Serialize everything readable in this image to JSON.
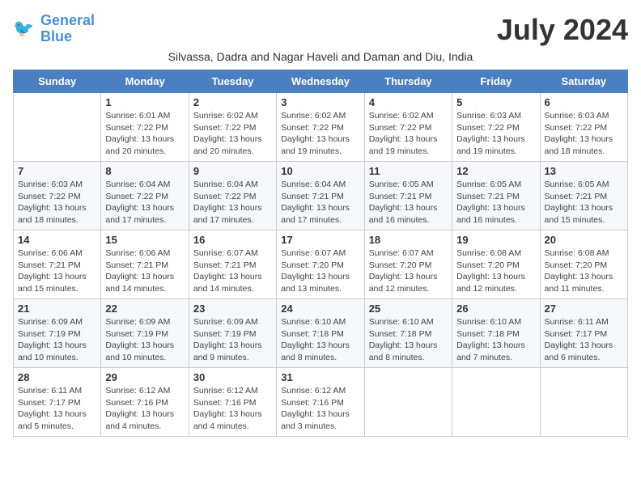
{
  "header": {
    "logo_line1": "General",
    "logo_line2": "Blue",
    "month_year": "July 2024",
    "subtitle": "Silvassa, Dadra and Nagar Haveli and Daman and Diu, India"
  },
  "days_of_week": [
    "Sunday",
    "Monday",
    "Tuesday",
    "Wednesday",
    "Thursday",
    "Friday",
    "Saturday"
  ],
  "weeks": [
    [
      {
        "day": "",
        "info": ""
      },
      {
        "day": "1",
        "info": "Sunrise: 6:01 AM\nSunset: 7:22 PM\nDaylight: 13 hours\nand 20 minutes."
      },
      {
        "day": "2",
        "info": "Sunrise: 6:02 AM\nSunset: 7:22 PM\nDaylight: 13 hours\nand 20 minutes."
      },
      {
        "day": "3",
        "info": "Sunrise: 6:02 AM\nSunset: 7:22 PM\nDaylight: 13 hours\nand 19 minutes."
      },
      {
        "day": "4",
        "info": "Sunrise: 6:02 AM\nSunset: 7:22 PM\nDaylight: 13 hours\nand 19 minutes."
      },
      {
        "day": "5",
        "info": "Sunrise: 6:03 AM\nSunset: 7:22 PM\nDaylight: 13 hours\nand 19 minutes."
      },
      {
        "day": "6",
        "info": "Sunrise: 6:03 AM\nSunset: 7:22 PM\nDaylight: 13 hours\nand 18 minutes."
      }
    ],
    [
      {
        "day": "7",
        "info": "Sunrise: 6:03 AM\nSunset: 7:22 PM\nDaylight: 13 hours\nand 18 minutes."
      },
      {
        "day": "8",
        "info": "Sunrise: 6:04 AM\nSunset: 7:22 PM\nDaylight: 13 hours\nand 17 minutes."
      },
      {
        "day": "9",
        "info": "Sunrise: 6:04 AM\nSunset: 7:22 PM\nDaylight: 13 hours\nand 17 minutes."
      },
      {
        "day": "10",
        "info": "Sunrise: 6:04 AM\nSunset: 7:21 PM\nDaylight: 13 hours\nand 17 minutes."
      },
      {
        "day": "11",
        "info": "Sunrise: 6:05 AM\nSunset: 7:21 PM\nDaylight: 13 hours\nand 16 minutes."
      },
      {
        "day": "12",
        "info": "Sunrise: 6:05 AM\nSunset: 7:21 PM\nDaylight: 13 hours\nand 16 minutes."
      },
      {
        "day": "13",
        "info": "Sunrise: 6:05 AM\nSunset: 7:21 PM\nDaylight: 13 hours\nand 15 minutes."
      }
    ],
    [
      {
        "day": "14",
        "info": "Sunrise: 6:06 AM\nSunset: 7:21 PM\nDaylight: 13 hours\nand 15 minutes."
      },
      {
        "day": "15",
        "info": "Sunrise: 6:06 AM\nSunset: 7:21 PM\nDaylight: 13 hours\nand 14 minutes."
      },
      {
        "day": "16",
        "info": "Sunrise: 6:07 AM\nSunset: 7:21 PM\nDaylight: 13 hours\nand 14 minutes."
      },
      {
        "day": "17",
        "info": "Sunrise: 6:07 AM\nSunset: 7:20 PM\nDaylight: 13 hours\nand 13 minutes."
      },
      {
        "day": "18",
        "info": "Sunrise: 6:07 AM\nSunset: 7:20 PM\nDaylight: 13 hours\nand 12 minutes."
      },
      {
        "day": "19",
        "info": "Sunrise: 6:08 AM\nSunset: 7:20 PM\nDaylight: 13 hours\nand 12 minutes."
      },
      {
        "day": "20",
        "info": "Sunrise: 6:08 AM\nSunset: 7:20 PM\nDaylight: 13 hours\nand 11 minutes."
      }
    ],
    [
      {
        "day": "21",
        "info": "Sunrise: 6:09 AM\nSunset: 7:19 PM\nDaylight: 13 hours\nand 10 minutes."
      },
      {
        "day": "22",
        "info": "Sunrise: 6:09 AM\nSunset: 7:19 PM\nDaylight: 13 hours\nand 10 minutes."
      },
      {
        "day": "23",
        "info": "Sunrise: 6:09 AM\nSunset: 7:19 PM\nDaylight: 13 hours\nand 9 minutes."
      },
      {
        "day": "24",
        "info": "Sunrise: 6:10 AM\nSunset: 7:18 PM\nDaylight: 13 hours\nand 8 minutes."
      },
      {
        "day": "25",
        "info": "Sunrise: 6:10 AM\nSunset: 7:18 PM\nDaylight: 13 hours\nand 8 minutes."
      },
      {
        "day": "26",
        "info": "Sunrise: 6:10 AM\nSunset: 7:18 PM\nDaylight: 13 hours\nand 7 minutes."
      },
      {
        "day": "27",
        "info": "Sunrise: 6:11 AM\nSunset: 7:17 PM\nDaylight: 13 hours\nand 6 minutes."
      }
    ],
    [
      {
        "day": "28",
        "info": "Sunrise: 6:11 AM\nSunset: 7:17 PM\nDaylight: 13 hours\nand 5 minutes."
      },
      {
        "day": "29",
        "info": "Sunrise: 6:12 AM\nSunset: 7:16 PM\nDaylight: 13 hours\nand 4 minutes."
      },
      {
        "day": "30",
        "info": "Sunrise: 6:12 AM\nSunset: 7:16 PM\nDaylight: 13 hours\nand 4 minutes."
      },
      {
        "day": "31",
        "info": "Sunrise: 6:12 AM\nSunset: 7:16 PM\nDaylight: 13 hours\nand 3 minutes."
      },
      {
        "day": "",
        "info": ""
      },
      {
        "day": "",
        "info": ""
      },
      {
        "day": "",
        "info": ""
      }
    ]
  ]
}
